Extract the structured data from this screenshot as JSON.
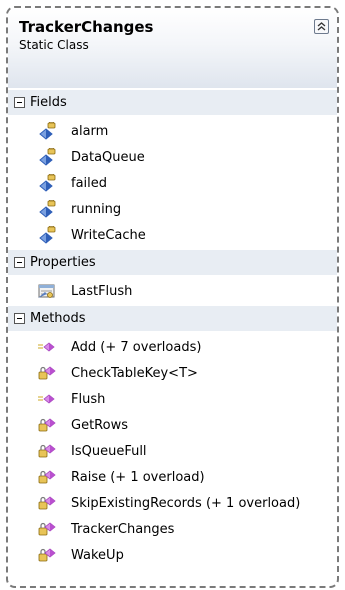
{
  "class": {
    "name": "TrackerChanges",
    "kind": "Static Class"
  },
  "sections": {
    "fields": {
      "label": "Fields",
      "items": [
        "alarm",
        "DataQueue",
        "failed",
        "running",
        "WriteCache"
      ]
    },
    "properties": {
      "label": "Properties",
      "items": [
        "LastFlush"
      ]
    },
    "methods": {
      "label": "Methods",
      "items": [
        "Add (+ 7 overloads)",
        "CheckTableKey<T>",
        "Flush",
        "GetRows",
        "IsQueueFull",
        "Raise (+ 1 overload)",
        "SkipExistingRecords (+ 1 overload)",
        "TrackerChanges",
        "WakeUp"
      ]
    }
  },
  "icons": {
    "collapse": "double-chevron-up-icon",
    "section_toggle": "minus-toggle-icon",
    "field": "private-field-icon",
    "property": "property-icon",
    "method_public": "public-method-icon",
    "method_private": "private-method-icon"
  },
  "colors": {
    "field_icon": "#2f5fb8",
    "method_icon": "#b94fcf",
    "section_background": "#e8edf3",
    "border": "#7a7a7a"
  }
}
